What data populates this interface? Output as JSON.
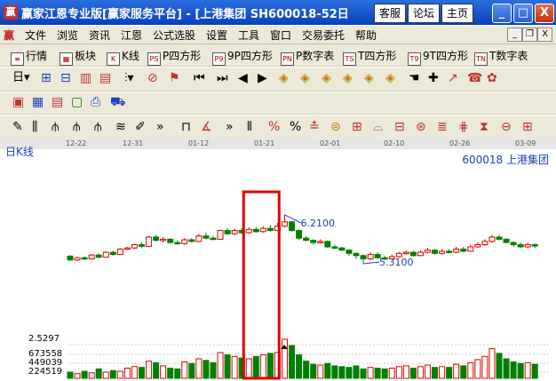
{
  "titlebar": {
    "app_icon": "赢",
    "title": "赢家江恩专业版[赢家服务平台] - [上港集团  SH600018-52日",
    "buttons": [
      "客服",
      "论坛",
      "主页"
    ]
  },
  "window_controls": {
    "minimize": "_",
    "maximize": "□",
    "close": "X"
  },
  "menubar": {
    "icon": "赢",
    "items": [
      "文件",
      "浏览",
      "资讯",
      "江恩",
      "公式选股",
      "设置",
      "工具",
      "窗口",
      "交易委托",
      "帮助"
    ],
    "mdi": [
      "_",
      "❐",
      "X"
    ]
  },
  "toolbar1": {
    "items": [
      {
        "icon": "list-icon",
        "badge": "≡",
        "label": "行情"
      },
      {
        "icon": "blocks-icon",
        "badge": "▦",
        "label": "板块"
      },
      {
        "icon": "kline-icon",
        "badge": "K",
        "label": "K线"
      },
      {
        "icon": "ps-icon",
        "badge": "PS",
        "label": "P四方形"
      },
      {
        "icon": "p9-icon",
        "badge": "P9",
        "label": "9P四方形"
      },
      {
        "icon": "pn-icon",
        "badge": "PN",
        "label": "P数字表"
      },
      {
        "icon": "ts-icon",
        "badge": "TS",
        "label": "T四方形"
      },
      {
        "icon": "t9-icon",
        "badge": "T9",
        "label": "9T四方形"
      },
      {
        "icon": "tn-icon",
        "badge": "TN",
        "label": "T数字表"
      }
    ]
  },
  "toolbar2": {
    "day_label": "日"
  },
  "chart": {
    "timeframe_label": "日K线",
    "stock_code": "600018",
    "stock_name": "上港集团",
    "dates": [
      "12-22",
      "12-31",
      "01-12",
      "01-21",
      "02-01",
      "02-10",
      "02-26",
      "03-09"
    ],
    "high_label": "6.2100",
    "low_label": "5.3100",
    "volume_labels": [
      "2.5297",
      "673558",
      "449039",
      "224519"
    ],
    "colors": {
      "up": "#e00000",
      "down": "#008000",
      "highlight": "#e00000",
      "label": "#1a3fc0"
    },
    "candles": [
      [
        5.45,
        5.38,
        5.47,
        5.36
      ],
      [
        5.38,
        5.42,
        5.44,
        5.36
      ],
      [
        5.42,
        5.4,
        5.45,
        5.38
      ],
      [
        5.4,
        5.47,
        5.49,
        5.39
      ],
      [
        5.47,
        5.43,
        5.5,
        5.41
      ],
      [
        5.43,
        5.52,
        5.54,
        5.42
      ],
      [
        5.52,
        5.48,
        5.55,
        5.46
      ],
      [
        5.48,
        5.58,
        5.6,
        5.47
      ],
      [
        5.58,
        5.6,
        5.62,
        5.56
      ],
      [
        5.6,
        5.66,
        5.68,
        5.58
      ],
      [
        5.66,
        5.63,
        5.7,
        5.6
      ],
      [
        5.63,
        5.8,
        5.82,
        5.62
      ],
      [
        5.8,
        5.74,
        5.84,
        5.72
      ],
      [
        5.74,
        5.76,
        5.8,
        5.7
      ],
      [
        5.76,
        5.7,
        5.78,
        5.68
      ],
      [
        5.7,
        5.68,
        5.74,
        5.66
      ],
      [
        5.68,
        5.75,
        5.78,
        5.66
      ],
      [
        5.75,
        5.72,
        5.78,
        5.7
      ],
      [
        5.72,
        5.82,
        5.86,
        5.71
      ],
      [
        5.82,
        5.78,
        5.88,
        5.76
      ],
      [
        5.78,
        5.76,
        5.82,
        5.74
      ],
      [
        5.76,
        5.92,
        5.94,
        5.75
      ],
      [
        5.92,
        5.86,
        5.96,
        5.84
      ],
      [
        5.86,
        5.92,
        5.95,
        5.84
      ],
      [
        5.92,
        5.88,
        5.96,
        5.86
      ],
      [
        5.88,
        5.94,
        5.98,
        5.86
      ],
      [
        5.94,
        5.9,
        5.99,
        5.88
      ],
      [
        5.9,
        5.96,
        6.0,
        5.88
      ],
      [
        5.96,
        5.92,
        6.02,
        5.9
      ],
      [
        5.92,
        6.0,
        6.06,
        5.91
      ],
      [
        6.0,
        6.08,
        6.21,
        5.98
      ],
      [
        6.08,
        5.92,
        6.1,
        5.9
      ],
      [
        5.92,
        5.78,
        5.95,
        5.75
      ],
      [
        5.78,
        5.74,
        5.82,
        5.72
      ],
      [
        5.74,
        5.7,
        5.76,
        5.66
      ],
      [
        5.7,
        5.72,
        5.76,
        5.68
      ],
      [
        5.72,
        5.62,
        5.74,
        5.6
      ],
      [
        5.62,
        5.6,
        5.66,
        5.58
      ],
      [
        5.6,
        5.56,
        5.62,
        5.54
      ],
      [
        5.56,
        5.5,
        5.58,
        5.46
      ],
      [
        5.5,
        5.46,
        5.52,
        5.4
      ],
      [
        5.46,
        5.4,
        5.48,
        5.31
      ],
      [
        5.4,
        5.48,
        5.52,
        5.38
      ],
      [
        5.48,
        5.42,
        5.52,
        5.4
      ],
      [
        5.42,
        5.4,
        5.46,
        5.38
      ],
      [
        5.4,
        5.44,
        5.48,
        5.38
      ],
      [
        5.44,
        5.5,
        5.53,
        5.42
      ],
      [
        5.5,
        5.52,
        5.55,
        5.48
      ],
      [
        5.52,
        5.46,
        5.55,
        5.44
      ],
      [
        5.46,
        5.52,
        5.56,
        5.45
      ],
      [
        5.52,
        5.56,
        5.6,
        5.5
      ],
      [
        5.56,
        5.5,
        5.58,
        5.48
      ],
      [
        5.5,
        5.54,
        5.58,
        5.48
      ],
      [
        5.54,
        5.52,
        5.58,
        5.5
      ],
      [
        5.52,
        5.58,
        5.62,
        5.5
      ],
      [
        5.58,
        5.54,
        5.62,
        5.52
      ],
      [
        5.54,
        5.62,
        5.66,
        5.53
      ],
      [
        5.62,
        5.66,
        5.7,
        5.6
      ],
      [
        5.66,
        5.72,
        5.76,
        5.64
      ],
      [
        5.72,
        5.8,
        5.84,
        5.7
      ],
      [
        5.8,
        5.76,
        5.84,
        5.74
      ],
      [
        5.76,
        5.7,
        5.78,
        5.68
      ],
      [
        5.7,
        5.66,
        5.72,
        5.62
      ],
      [
        5.66,
        5.62,
        5.7,
        5.6
      ],
      [
        5.62,
        5.66,
        5.7,
        5.6
      ],
      [
        5.66,
        5.64,
        5.68,
        5.6
      ]
    ],
    "volumes": [
      80,
      60,
      90,
      70,
      120,
      80,
      100,
      90,
      130,
      150,
      140,
      220,
      200,
      160,
      130,
      120,
      210,
      190,
      250,
      230,
      200,
      330,
      300,
      280,
      260,
      250,
      280,
      300,
      320,
      330,
      500,
      420,
      300,
      220,
      180,
      170,
      190,
      160,
      150,
      140,
      160,
      120,
      140,
      130,
      120,
      130,
      150,
      160,
      130,
      150,
      170,
      140,
      150,
      140,
      180,
      160,
      200,
      240,
      280,
      380,
      320,
      250,
      210,
      190,
      200,
      180
    ],
    "vol_max": 673558
  }
}
